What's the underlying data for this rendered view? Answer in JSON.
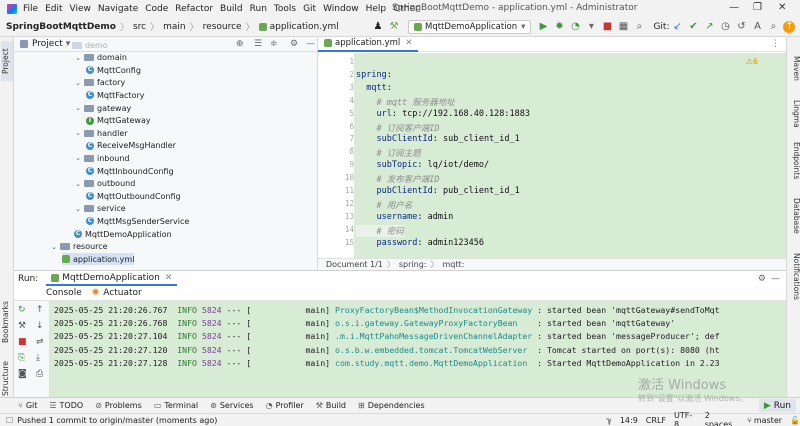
{
  "menu": {
    "items": [
      "File",
      "Edit",
      "View",
      "Navigate",
      "Code",
      "Refactor",
      "Build",
      "Run",
      "Tools",
      "Git",
      "Window",
      "Help",
      "Other"
    ],
    "window_title": "SpringBootMqttDemo - application.yml - Administrator"
  },
  "nav": {
    "project": "SpringBootMqttDemo",
    "path": [
      "src",
      "main",
      "resource",
      "application.yml"
    ],
    "run_config": "MqttDemoApplication",
    "git_label": "Git:"
  },
  "left_strip": {
    "project": "Project",
    "bookmarks": "Bookmarks",
    "structure": "Structure"
  },
  "right_strip": {
    "maven": "Maven",
    "lingma": "Lingma",
    "endpoints": "Endpoints",
    "database": "Database",
    "notifications": "Notifications"
  },
  "project_panel": {
    "title": "Project",
    "tree": [
      {
        "label": "demo",
        "kind": "folder",
        "open": true,
        "depth": 0
      },
      {
        "label": "domain",
        "kind": "folder",
        "open": true,
        "depth": 1
      },
      {
        "label": "MqttConfig",
        "kind": "class",
        "depth": 2
      },
      {
        "label": "factory",
        "kind": "folder",
        "open": true,
        "depth": 1
      },
      {
        "label": "MqttFactory",
        "kind": "class",
        "depth": 2
      },
      {
        "label": "gateway",
        "kind": "folder",
        "open": true,
        "depth": 1
      },
      {
        "label": "MqttGateway",
        "kind": "interface",
        "depth": 2
      },
      {
        "label": "handler",
        "kind": "folder",
        "open": true,
        "depth": 1
      },
      {
        "label": "ReceiveMsgHandler",
        "kind": "class",
        "depth": 2
      },
      {
        "label": "inbound",
        "kind": "folder",
        "open": true,
        "depth": 1
      },
      {
        "label": "MqttInboundConfig",
        "kind": "class",
        "depth": 2
      },
      {
        "label": "outbound",
        "kind": "folder",
        "open": true,
        "depth": 1
      },
      {
        "label": "MqttOutboundConfig",
        "kind": "class",
        "depth": 2
      },
      {
        "label": "service",
        "kind": "folder",
        "open": true,
        "depth": 1
      },
      {
        "label": "MqttMsgSenderService",
        "kind": "class",
        "depth": 2
      },
      {
        "label": "MqttDemoApplication",
        "kind": "class",
        "depth": 1
      },
      {
        "label": "resource",
        "kind": "folder",
        "open": true,
        "depth": -1
      },
      {
        "label": "application.yml",
        "kind": "yml",
        "depth": 0
      }
    ]
  },
  "editor": {
    "tab": "application.yml",
    "warnings": "6",
    "line_numbers": [
      "1",
      "2",
      "3",
      "4",
      "5",
      "6",
      "7",
      "8",
      "9",
      "10",
      "11",
      "12",
      "13",
      "14",
      "15"
    ],
    "lines": [
      {
        "text": ""
      },
      {
        "key": "spring",
        "value": ":"
      },
      {
        "key": "  mqtt",
        "value": ":"
      },
      {
        "comment": "    # mqtt 服务器地址"
      },
      {
        "key": "    url",
        "value": ": tcp://192.168.40.128:1883"
      },
      {
        "comment": "    # 订阅客户端ID"
      },
      {
        "key": "    subClientId",
        "value": ": sub_client_id_1",
        "hl": true
      },
      {
        "comment": "    # 订阅主题"
      },
      {
        "key": "    subTopic",
        "value": ": lq/iot/demo/",
        "hl": true
      },
      {
        "comment": "    # 发布客户端ID"
      },
      {
        "key": "    pubClientId",
        "value": ": pub_client_id_1",
        "hl": true
      },
      {
        "comment": "    # 用户名"
      },
      {
        "key": "    username",
        "value": ": admin",
        "hl": true
      },
      {
        "comment": "    # 密码"
      },
      {
        "key": "    password",
        "value": ": admin123456",
        "hl": true
      }
    ],
    "breadcrumb": [
      "Document 1/1",
      "spring:",
      "mqtt:"
    ]
  },
  "run_panel": {
    "label": "Run:",
    "config_tab": "MqttDemoApplication",
    "console_tab": "Console",
    "actuator_tab": "Actuator",
    "logs": [
      {
        "time": "2025-05-25 21:20:26.767",
        "level": "INFO",
        "pid": "5824",
        "sep": "--- [",
        "thread": "main]",
        "logger": "ProxyFactoryBean$MethodInvocationGateway",
        "msg": ": started bean 'mqttGateway#sendToMqt"
      },
      {
        "time": "2025-05-25 21:20:26.768",
        "level": "INFO",
        "pid": "5824",
        "sep": "--- [",
        "thread": "main]",
        "logger": "o.s.i.gateway.GatewayProxyFactoryBean   ",
        "msg": ": started bean 'mqttGateway'"
      },
      {
        "time": "2025-05-25 21:20:27.104",
        "level": "INFO",
        "pid": "5824",
        "sep": "--- [",
        "thread": "main]",
        "logger": ".m.i.MqttPahoMessageDrivenChannelAdapter",
        "msg": ": started bean 'messageProducer'; def"
      },
      {
        "time": "2025-05-25 21:20:27.120",
        "level": "INFO",
        "pid": "5824",
        "sep": "--- [",
        "thread": "main]",
        "logger": "o.s.b.w.embedded.tomcat.TomcatWebServer ",
        "msg": ": Tomcat started on port(s): 8080 (ht"
      },
      {
        "time": "2025-05-25 21:20:27.128",
        "level": "INFO",
        "pid": "5824",
        "sep": "--- [",
        "thread": "main]",
        "logger": "com.study.mqtt.demo.MqttDemoApplication ",
        "msg": ": Started MqttDemoApplication in 2.23"
      }
    ]
  },
  "tool_tabs": [
    "Git",
    "TODO",
    "Problems",
    "Terminal",
    "Services",
    "Profiler",
    "Build",
    "Dependencies"
  ],
  "run_button": "Run",
  "status": {
    "message": "Pushed 1 commit to origin/master (moments ago)",
    "position": "14:9",
    "line_sep": "CRLF",
    "encoding": "UTF-8",
    "indent": "2 spaces",
    "branch": "master"
  },
  "watermark": {
    "line1": "激活 Windows",
    "line2": "转到\"设置\"以激活 Windows。"
  },
  "colors": {
    "accent": "#3574f0",
    "code_bg": "#d7ebd5",
    "key": "#0a2a86",
    "comment": "#8c8c8c",
    "info": "#2e7a2e"
  }
}
